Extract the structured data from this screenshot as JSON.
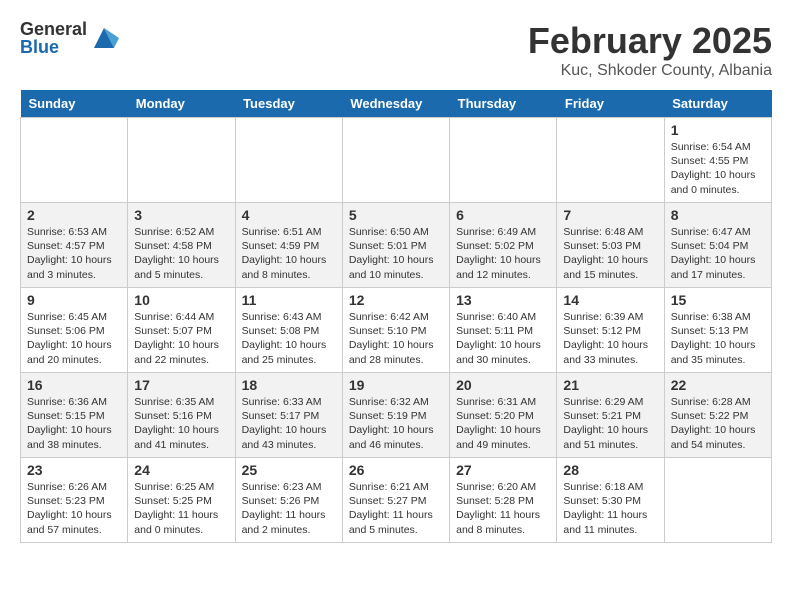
{
  "header": {
    "logo_general": "General",
    "logo_blue": "Blue",
    "month_title": "February 2025",
    "location": "Kuc, Shkoder County, Albania"
  },
  "days_of_week": [
    "Sunday",
    "Monday",
    "Tuesday",
    "Wednesday",
    "Thursday",
    "Friday",
    "Saturday"
  ],
  "weeks": [
    [
      {
        "day": "",
        "info": ""
      },
      {
        "day": "",
        "info": ""
      },
      {
        "day": "",
        "info": ""
      },
      {
        "day": "",
        "info": ""
      },
      {
        "day": "",
        "info": ""
      },
      {
        "day": "",
        "info": ""
      },
      {
        "day": "1",
        "info": "Sunrise: 6:54 AM\nSunset: 4:55 PM\nDaylight: 10 hours\nand 0 minutes."
      }
    ],
    [
      {
        "day": "2",
        "info": "Sunrise: 6:53 AM\nSunset: 4:57 PM\nDaylight: 10 hours\nand 3 minutes."
      },
      {
        "day": "3",
        "info": "Sunrise: 6:52 AM\nSunset: 4:58 PM\nDaylight: 10 hours\nand 5 minutes."
      },
      {
        "day": "4",
        "info": "Sunrise: 6:51 AM\nSunset: 4:59 PM\nDaylight: 10 hours\nand 8 minutes."
      },
      {
        "day": "5",
        "info": "Sunrise: 6:50 AM\nSunset: 5:01 PM\nDaylight: 10 hours\nand 10 minutes."
      },
      {
        "day": "6",
        "info": "Sunrise: 6:49 AM\nSunset: 5:02 PM\nDaylight: 10 hours\nand 12 minutes."
      },
      {
        "day": "7",
        "info": "Sunrise: 6:48 AM\nSunset: 5:03 PM\nDaylight: 10 hours\nand 15 minutes."
      },
      {
        "day": "8",
        "info": "Sunrise: 6:47 AM\nSunset: 5:04 PM\nDaylight: 10 hours\nand 17 minutes."
      }
    ],
    [
      {
        "day": "9",
        "info": "Sunrise: 6:45 AM\nSunset: 5:06 PM\nDaylight: 10 hours\nand 20 minutes."
      },
      {
        "day": "10",
        "info": "Sunrise: 6:44 AM\nSunset: 5:07 PM\nDaylight: 10 hours\nand 22 minutes."
      },
      {
        "day": "11",
        "info": "Sunrise: 6:43 AM\nSunset: 5:08 PM\nDaylight: 10 hours\nand 25 minutes."
      },
      {
        "day": "12",
        "info": "Sunrise: 6:42 AM\nSunset: 5:10 PM\nDaylight: 10 hours\nand 28 minutes."
      },
      {
        "day": "13",
        "info": "Sunrise: 6:40 AM\nSunset: 5:11 PM\nDaylight: 10 hours\nand 30 minutes."
      },
      {
        "day": "14",
        "info": "Sunrise: 6:39 AM\nSunset: 5:12 PM\nDaylight: 10 hours\nand 33 minutes."
      },
      {
        "day": "15",
        "info": "Sunrise: 6:38 AM\nSunset: 5:13 PM\nDaylight: 10 hours\nand 35 minutes."
      }
    ],
    [
      {
        "day": "16",
        "info": "Sunrise: 6:36 AM\nSunset: 5:15 PM\nDaylight: 10 hours\nand 38 minutes."
      },
      {
        "day": "17",
        "info": "Sunrise: 6:35 AM\nSunset: 5:16 PM\nDaylight: 10 hours\nand 41 minutes."
      },
      {
        "day": "18",
        "info": "Sunrise: 6:33 AM\nSunset: 5:17 PM\nDaylight: 10 hours\nand 43 minutes."
      },
      {
        "day": "19",
        "info": "Sunrise: 6:32 AM\nSunset: 5:19 PM\nDaylight: 10 hours\nand 46 minutes."
      },
      {
        "day": "20",
        "info": "Sunrise: 6:31 AM\nSunset: 5:20 PM\nDaylight: 10 hours\nand 49 minutes."
      },
      {
        "day": "21",
        "info": "Sunrise: 6:29 AM\nSunset: 5:21 PM\nDaylight: 10 hours\nand 51 minutes."
      },
      {
        "day": "22",
        "info": "Sunrise: 6:28 AM\nSunset: 5:22 PM\nDaylight: 10 hours\nand 54 minutes."
      }
    ],
    [
      {
        "day": "23",
        "info": "Sunrise: 6:26 AM\nSunset: 5:23 PM\nDaylight: 10 hours\nand 57 minutes."
      },
      {
        "day": "24",
        "info": "Sunrise: 6:25 AM\nSunset: 5:25 PM\nDaylight: 11 hours\nand 0 minutes."
      },
      {
        "day": "25",
        "info": "Sunrise: 6:23 AM\nSunset: 5:26 PM\nDaylight: 11 hours\nand 2 minutes."
      },
      {
        "day": "26",
        "info": "Sunrise: 6:21 AM\nSunset: 5:27 PM\nDaylight: 11 hours\nand 5 minutes."
      },
      {
        "day": "27",
        "info": "Sunrise: 6:20 AM\nSunset: 5:28 PM\nDaylight: 11 hours\nand 8 minutes."
      },
      {
        "day": "28",
        "info": "Sunrise: 6:18 AM\nSunset: 5:30 PM\nDaylight: 11 hours\nand 11 minutes."
      },
      {
        "day": "",
        "info": ""
      }
    ]
  ]
}
